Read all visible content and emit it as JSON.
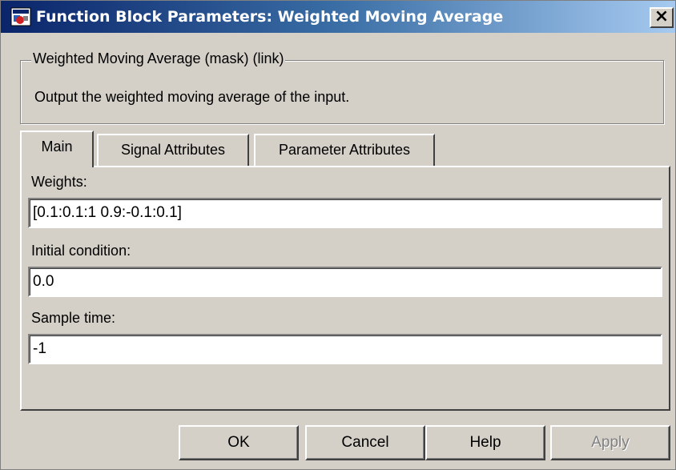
{
  "window": {
    "title": "Function Block Parameters: Weighted Moving Average",
    "close_label": "×"
  },
  "mask": {
    "group_title": "Weighted Moving Average (mask) (link)",
    "description": "Output the weighted moving average of the input."
  },
  "tabs": [
    {
      "label": "Main",
      "active": true
    },
    {
      "label": "Signal Attributes",
      "active": false
    },
    {
      "label": "Parameter Attributes",
      "active": false
    }
  ],
  "fields": {
    "weights": {
      "label": "Weights:",
      "value": "[0.1:0.1:1 0.9:-0.1:0.1]"
    },
    "initial_condition": {
      "label": "Initial condition:",
      "value": "0.0"
    },
    "sample_time": {
      "label": "Sample time:",
      "value": "-1"
    }
  },
  "buttons": {
    "ok": "OK",
    "cancel": "Cancel",
    "help": "Help",
    "apply": "Apply"
  },
  "colors": {
    "dialog_face": "#d4d0c8",
    "titlebar_start": "#0a246a",
    "titlebar_end": "#a6caf0"
  },
  "icons": {
    "title": "simulink-block-icon",
    "close": "close-icon"
  }
}
